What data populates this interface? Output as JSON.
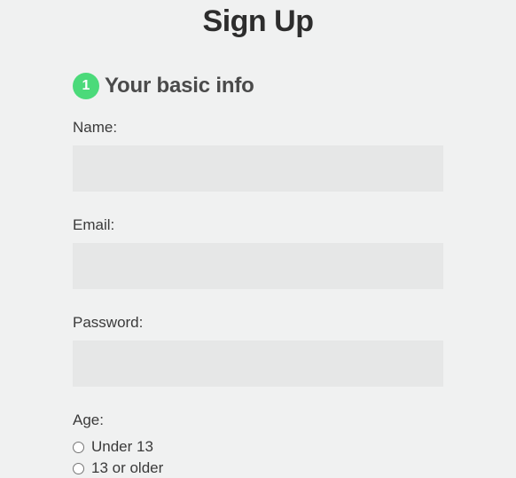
{
  "page": {
    "title": "Sign Up"
  },
  "section": {
    "step_number": "1",
    "title": "Your basic info"
  },
  "fields": {
    "name_label": "Name:",
    "name_value": "",
    "email_label": "Email:",
    "email_value": "",
    "password_label": "Password:",
    "password_value": "",
    "age_label": "Age:",
    "age_options": [
      {
        "label": "Under 13"
      },
      {
        "label": "13 or older"
      }
    ]
  }
}
